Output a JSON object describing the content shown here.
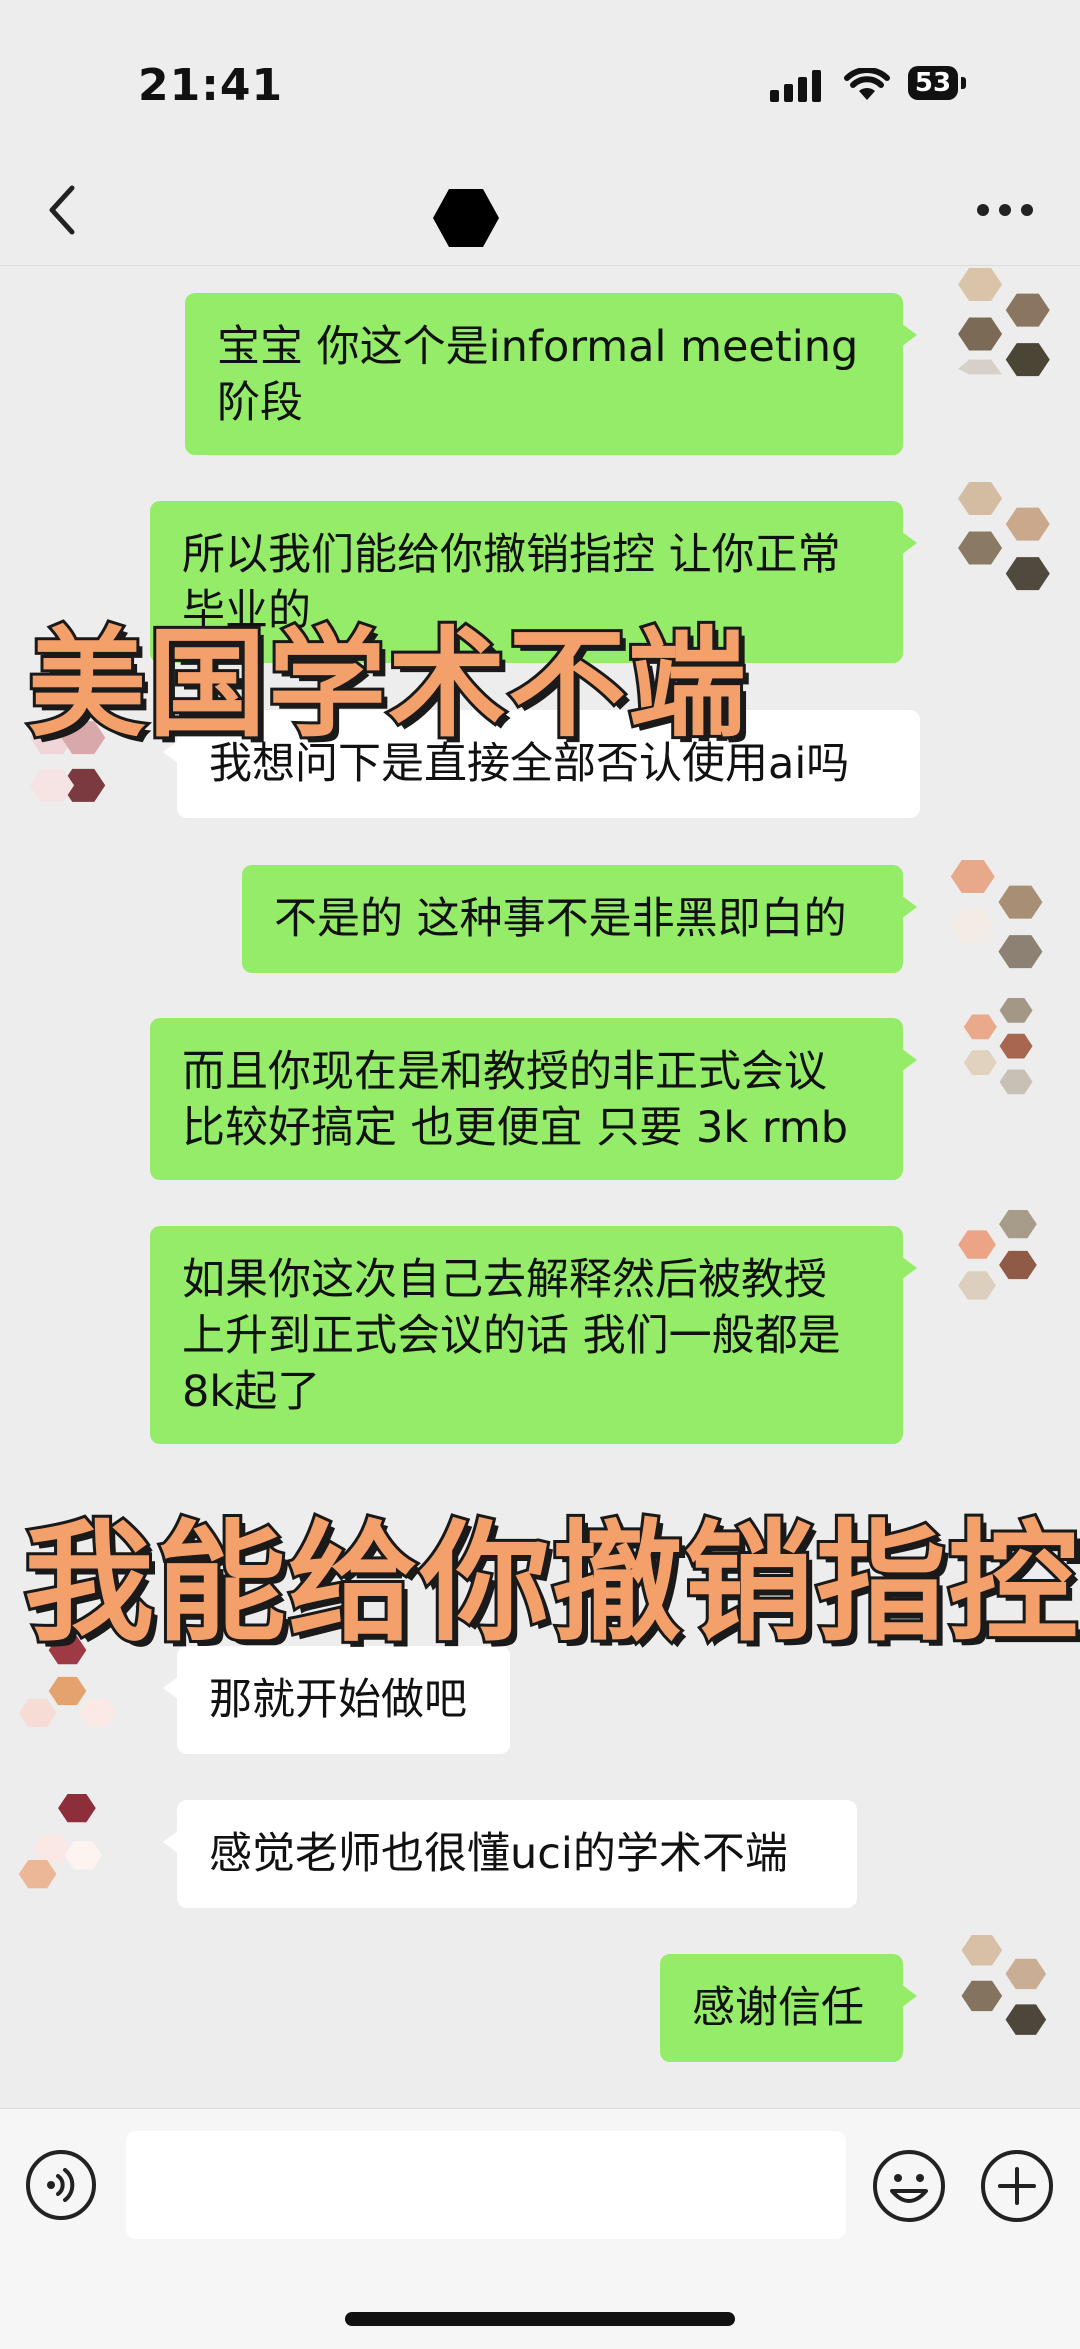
{
  "status_bar": {
    "time": "21:41",
    "battery": "53",
    "icons": [
      "signal-icon",
      "wifi-icon",
      "battery-icon"
    ]
  },
  "nav": {
    "back_icon": "chevron-left-icon",
    "title_icon": "hexagon-avatar-icon",
    "more_icon": "more-icon"
  },
  "messages": [
    {
      "side": "out",
      "text": "宝宝 你这个是informal meeting\n阶段"
    },
    {
      "side": "out",
      "text": "所以我们能给你撤销指控 让你正常\n毕业的"
    },
    {
      "side": "in",
      "text": "我想问下是直接全部否认使用ai吗"
    },
    {
      "side": "out",
      "text": "不是的 这种事不是非黑即白的"
    },
    {
      "side": "out",
      "text": "而且你现在是和教授的非正式会议\n比较好搞定 也更便宜 只要 3k rmb"
    },
    {
      "side": "out",
      "text": "如果你这次自己去解释然后被教授\n上升到正式会议的话 我们一般都是\n8k起了"
    },
    {
      "side": "in",
      "text": "那就开始做吧"
    },
    {
      "side": "in",
      "text": "感觉老师也很懂uci的学术不端"
    },
    {
      "side": "out",
      "text": "感谢信任"
    }
  ],
  "overlays": {
    "top": "美国学术不端",
    "bottom": "我能给你撤销指控"
  },
  "input_bar": {
    "placeholder": "",
    "voice_icon": "voice-icon",
    "emoji_icon": "emoji-icon",
    "plus_icon": "plus-icon"
  },
  "colors": {
    "background": "#ededed",
    "outgoing_bubble": "#95ec69",
    "incoming_bubble": "#ffffff",
    "overlay_fill": "#f4a06b",
    "overlay_stroke": "#1a1a1a"
  }
}
